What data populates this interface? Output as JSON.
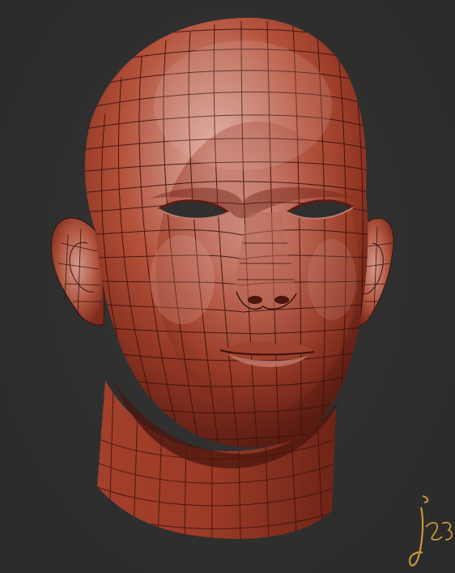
{
  "scene": {
    "subject": "head-sculpt",
    "wireframe": true,
    "colors": {
      "background": "#2f2f2f",
      "skin_base": "#b4513a",
      "skin_highlight": "#d9a39a",
      "skin_shadow": "#5a1c12",
      "wire": "#3a120c",
      "signature": "#c9963a"
    }
  },
  "signature": {
    "text": "j23"
  }
}
